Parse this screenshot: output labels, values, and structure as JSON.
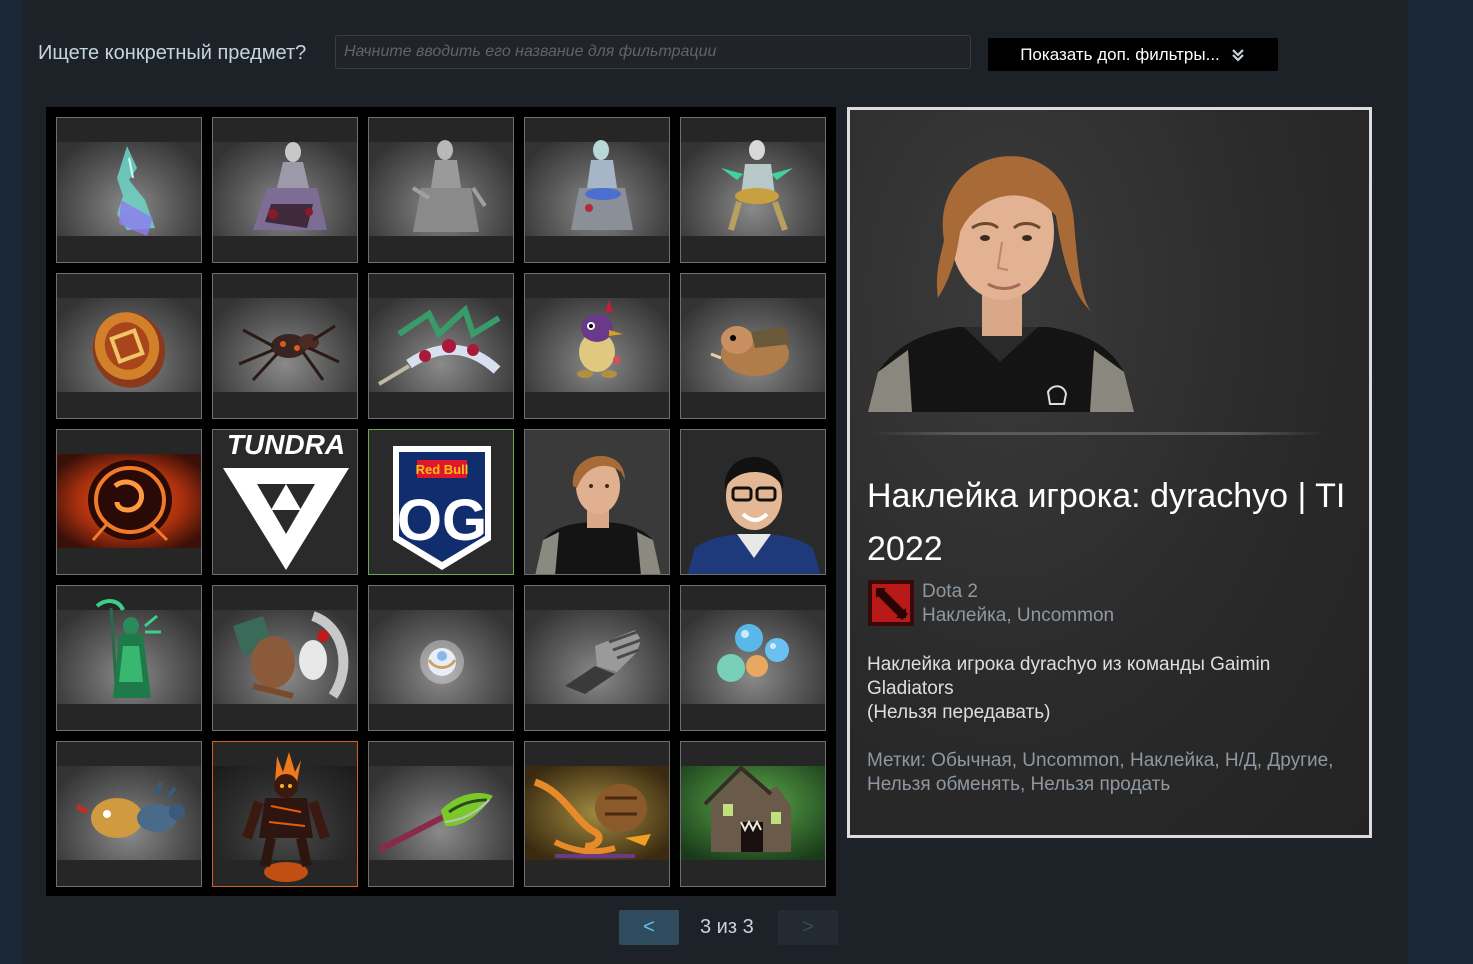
{
  "filter": {
    "label": "Ищете конкретный предмет?",
    "placeholder": "Начните вводить его название для фильтрации",
    "more_filters_label": "Показать доп. фильтры...",
    "more_filters_icon": "double-chevron-down-icon"
  },
  "inventory": {
    "items": [
      {
        "name": "item-ethereal-wisp",
        "selected": false
      },
      {
        "name": "item-dark-dress-hero",
        "selected": false
      },
      {
        "name": "item-grey-ghost-hero",
        "selected": false
      },
      {
        "name": "item-blue-ghost-hero",
        "selected": false
      },
      {
        "name": "item-golden-armor-hero",
        "selected": false
      },
      {
        "name": "item-dota-coin",
        "selected": false
      },
      {
        "name": "item-spider-courier",
        "selected": false
      },
      {
        "name": "item-thorn-weapon",
        "selected": false
      },
      {
        "name": "item-bird-courier",
        "selected": false
      },
      {
        "name": "item-hamster-courier",
        "selected": false
      },
      {
        "name": "item-fire-emblem",
        "selected": false
      },
      {
        "name": "item-tundra-sticker",
        "label": "TUNDRA",
        "selected": false
      },
      {
        "name": "item-og-sticker",
        "label": "OG",
        "brand": "Red Bull",
        "selected": "green"
      },
      {
        "name": "item-player-sticker-dyrachyo",
        "selected": false
      },
      {
        "name": "item-player-sticker-glasses",
        "selected": false
      },
      {
        "name": "item-green-reaper",
        "selected": false
      },
      {
        "name": "item-bone-armor-set",
        "selected": false
      },
      {
        "name": "item-glowing-orb",
        "selected": false
      },
      {
        "name": "item-metal-gauntlet",
        "selected": false
      },
      {
        "name": "item-bubble-set",
        "selected": false
      },
      {
        "name": "item-flying-boar-courier",
        "selected": false
      },
      {
        "name": "item-fire-golem",
        "selected": "orange"
      },
      {
        "name": "item-green-spear",
        "selected": false
      },
      {
        "name": "item-tentacle-pot",
        "selected": false
      },
      {
        "name": "item-haunted-house-loading",
        "selected": false
      }
    ]
  },
  "detail": {
    "title": "Наклейка игрока: dyrachyo | TI 2022",
    "game_name": "Dota 2",
    "item_type": "Наклейка, Uncommon",
    "description_line1": "Наклейка игрока dyrachyo из команды Gaimin Gladiators",
    "description_line2": "(Нельзя передавать)",
    "tags": "Метки: Обычная, Uncommon, Наклейка, Н/Д, Другие, Нельзя обменять, Нельзя продать",
    "game_icon": "dota2-icon"
  },
  "pager": {
    "prev_label": "<",
    "page_text": "3 из 3",
    "next_label": ">"
  },
  "colors": {
    "background": "#1d2228",
    "selected_green": "#6aa84f",
    "selected_orange": "#d2601e",
    "accent_blue": "#66c0f4"
  }
}
